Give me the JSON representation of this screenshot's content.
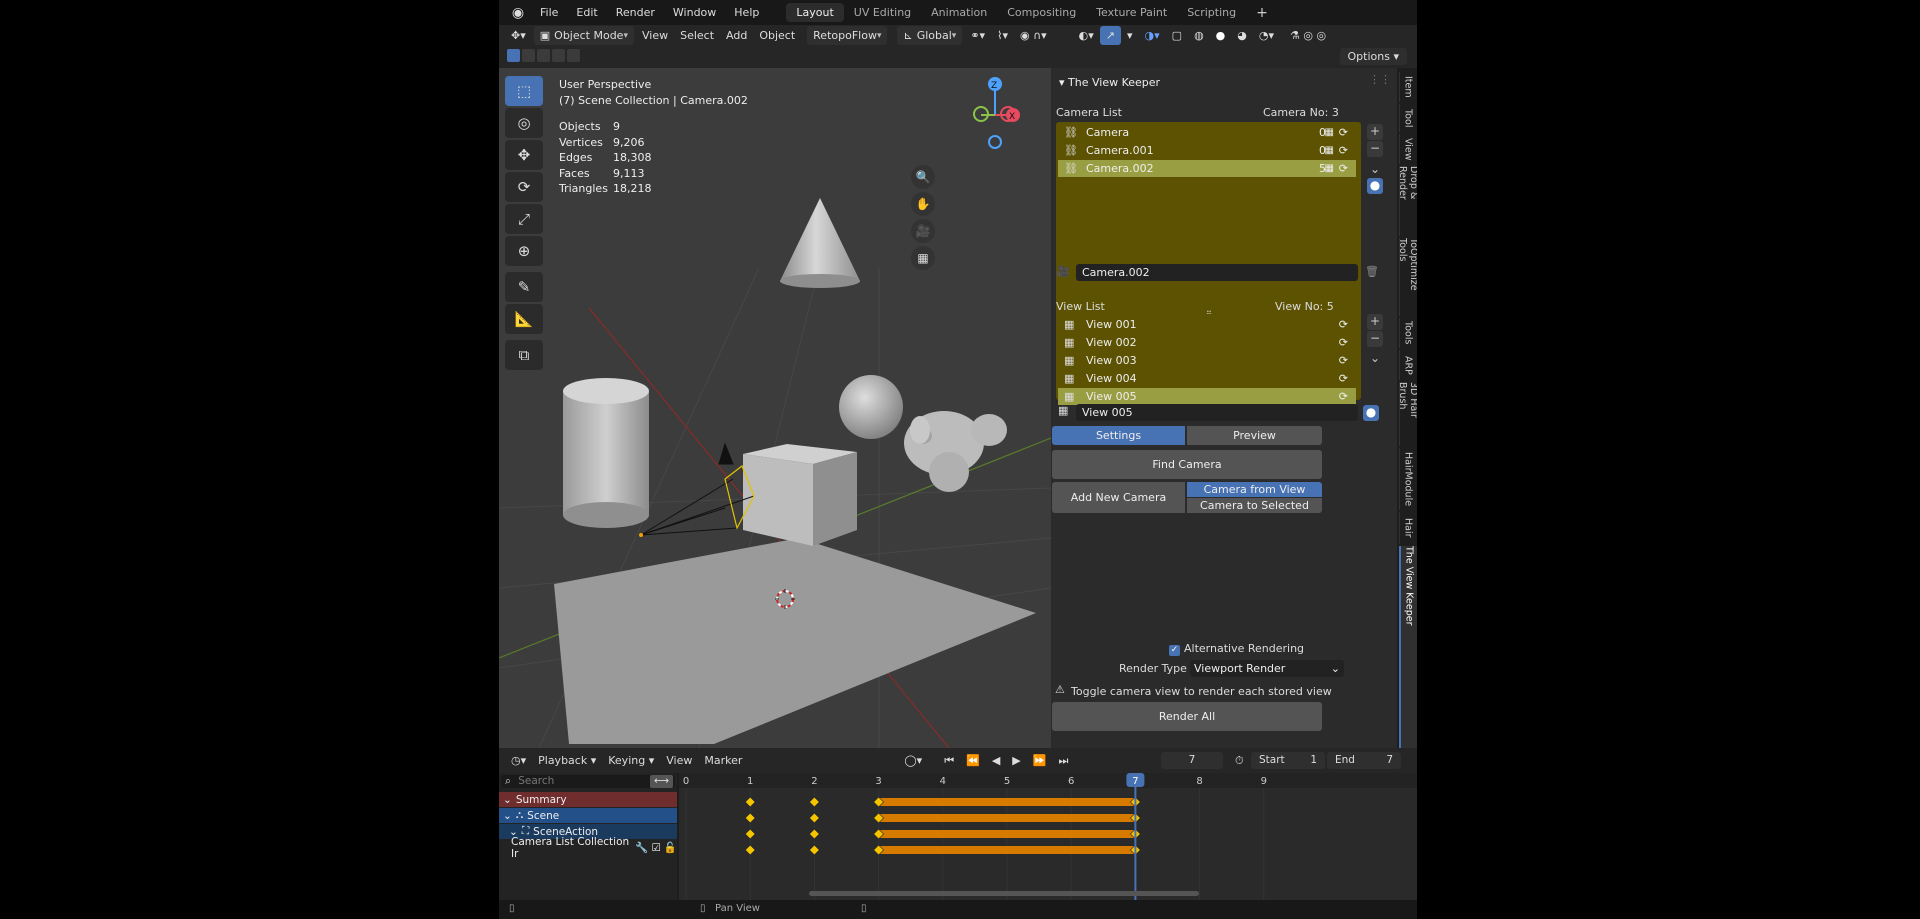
{
  "topbar": {
    "menu": [
      "File",
      "Edit",
      "Render",
      "Window",
      "Help"
    ],
    "workspaces": [
      "Layout",
      "UV Editing",
      "Animation",
      "Compositing",
      "Texture Paint",
      "Scripting"
    ],
    "active_workspace": "Layout",
    "add_workspace": "+"
  },
  "viewport_header": {
    "mode": "Object Mode",
    "menus": [
      "View",
      "Select",
      "Add",
      "Object"
    ],
    "addon_menu": "RetopoFlow",
    "orientation": "Global",
    "options_label": "Options"
  },
  "viewport": {
    "view_name": "User Perspective",
    "collection": "(7) Scene Collection | Camera.002",
    "stats": [
      {
        "label": "Objects",
        "value": "9"
      },
      {
        "label": "Vertices",
        "value": "9,206"
      },
      {
        "label": "Edges",
        "value": "18,308"
      },
      {
        "label": "Faces",
        "value": "9,113"
      },
      {
        "label": "Triangles",
        "value": "18,218"
      }
    ],
    "gizmo": {
      "z": "Z",
      "x": "X"
    }
  },
  "view_keeper": {
    "title": "The View Keeper",
    "camera_list_label": "Camera List",
    "camera_count_label": "Camera No:  3",
    "cameras": [
      {
        "name": "Camera",
        "count": "0",
        "selected": false
      },
      {
        "name": "Camera.001",
        "count": "0",
        "selected": false
      },
      {
        "name": "Camera.002",
        "count": "5",
        "selected": true
      }
    ],
    "active_camera_name": "Camera.002",
    "view_list_label": "View List",
    "view_count_label": "View No:  5",
    "views": [
      {
        "name": "View 001",
        "selected": false
      },
      {
        "name": "View 002",
        "selected": false
      },
      {
        "name": "View 003",
        "selected": false
      },
      {
        "name": "View 004",
        "selected": false
      },
      {
        "name": "View 005",
        "selected": true
      }
    ],
    "active_view_name": "View 005",
    "tabs": {
      "settings": "Settings",
      "preview": "Preview"
    },
    "find_camera": "Find Camera",
    "add_new_camera": "Add New Camera",
    "camera_from_view": "Camera from View",
    "camera_to_selected": "Camera to Selected",
    "alternative_rendering": "Alternative Rendering",
    "render_type_label": "Render Type",
    "render_type_value": "Viewport Render",
    "hint": "Toggle camera view to render each stored view",
    "render_all": "Render All"
  },
  "side_tabs": [
    "Item",
    "Tool",
    "View",
    "Drop & Render",
    "ToOptimize Tools",
    "Tools",
    "ARP",
    "3D Hair Brush",
    "HairModule",
    "Hair",
    "The View Keeper"
  ],
  "timeline": {
    "menus": [
      "Playback",
      "Keying",
      "View",
      "Marker"
    ],
    "current_frame": "7",
    "start_label": "Start",
    "start_value": "1",
    "end_label": "End",
    "end_value": "7",
    "search_placeholder": "Search",
    "channels": [
      "Summary",
      "Scene",
      "SceneAction",
      "Camera List Collection Ir"
    ],
    "frame_ticks": [
      "0",
      "1",
      "2",
      "3",
      "4",
      "5",
      "6",
      "7",
      "8",
      "9"
    ],
    "playhead": "7",
    "keyframes": [
      1,
      2,
      3,
      7
    ],
    "hold_range": [
      3,
      7
    ]
  },
  "statusbar": {
    "center": "Pan View"
  },
  "colors": {
    "accent": "#4772b3",
    "list_bg": "#5c5202",
    "list_sel": "#9a9e42",
    "hold_bar": "#d77a00",
    "keyframe": "#f5c400"
  }
}
